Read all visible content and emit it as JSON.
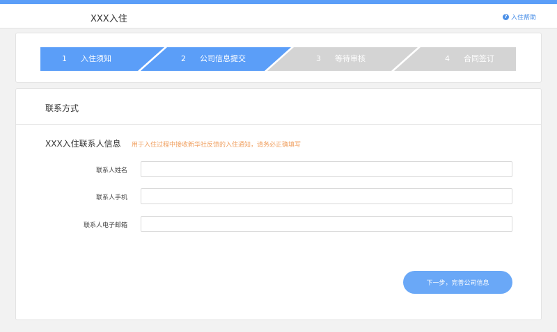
{
  "header": {
    "brand": "XXX入住",
    "help_label": "入住帮助"
  },
  "steps": [
    {
      "num": "1",
      "label": "入住须知",
      "active": true
    },
    {
      "num": "2",
      "label": "公司信息提交",
      "active": true
    },
    {
      "num": "3",
      "label": "等待审核",
      "active": false
    },
    {
      "num": "4",
      "label": "合同签订",
      "active": false
    }
  ],
  "colors": {
    "active": "#5b9ef8",
    "inactive": "#d4d4d4",
    "hint": "#f0a060",
    "button": "#6aa8f7"
  },
  "form": {
    "section_title": "联系方式",
    "sub_title": "XXX入住联系人信息",
    "hint": "用于入住过程中接收新华社反馈的入住通知，请务必正确填写",
    "fields": [
      {
        "label": "联系人姓名",
        "value": "",
        "placeholder": ""
      },
      {
        "label": "联系人手机",
        "value": "",
        "placeholder": ""
      },
      {
        "label": "联系人电子邮箱",
        "value": "",
        "placeholder": ""
      }
    ],
    "next_button": "下一步，完善公司信息"
  }
}
